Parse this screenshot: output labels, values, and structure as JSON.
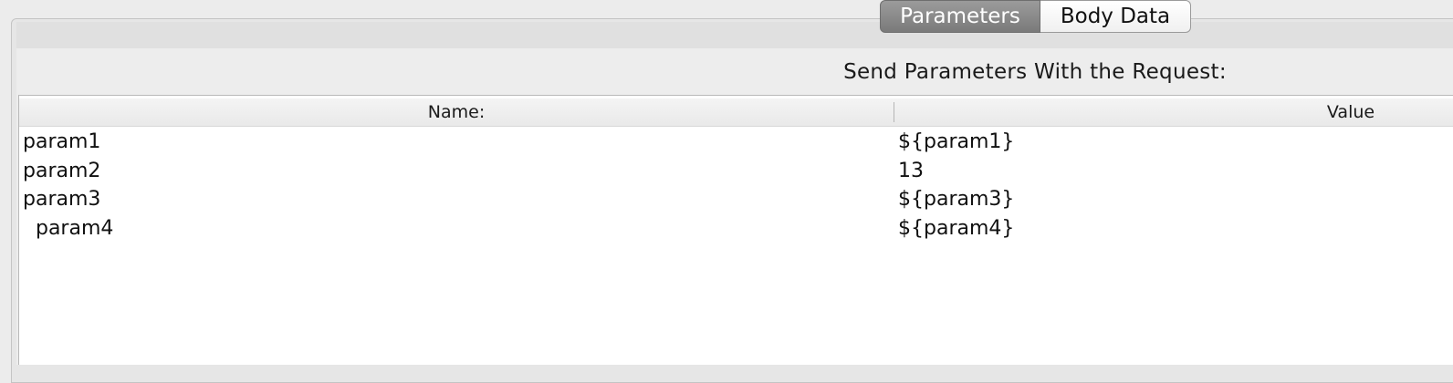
{
  "tabs": [
    {
      "label": "Parameters",
      "active": true
    },
    {
      "label": "Body Data",
      "active": false
    }
  ],
  "section": {
    "title": "Send Parameters With the Request:"
  },
  "table": {
    "columns": [
      "Name:",
      "Value"
    ],
    "rows": [
      {
        "name": "param1",
        "value": "${param1}"
      },
      {
        "name": "param2",
        "value": "13"
      },
      {
        "name": "param3",
        "value": "${param3}"
      },
      {
        "name": "  param4",
        "value": "${param4}"
      }
    ]
  },
  "colors": {
    "active_tab_bg": "#8a8a8a",
    "panel_bg": "#ededed",
    "table_bg": "#ffffff"
  }
}
